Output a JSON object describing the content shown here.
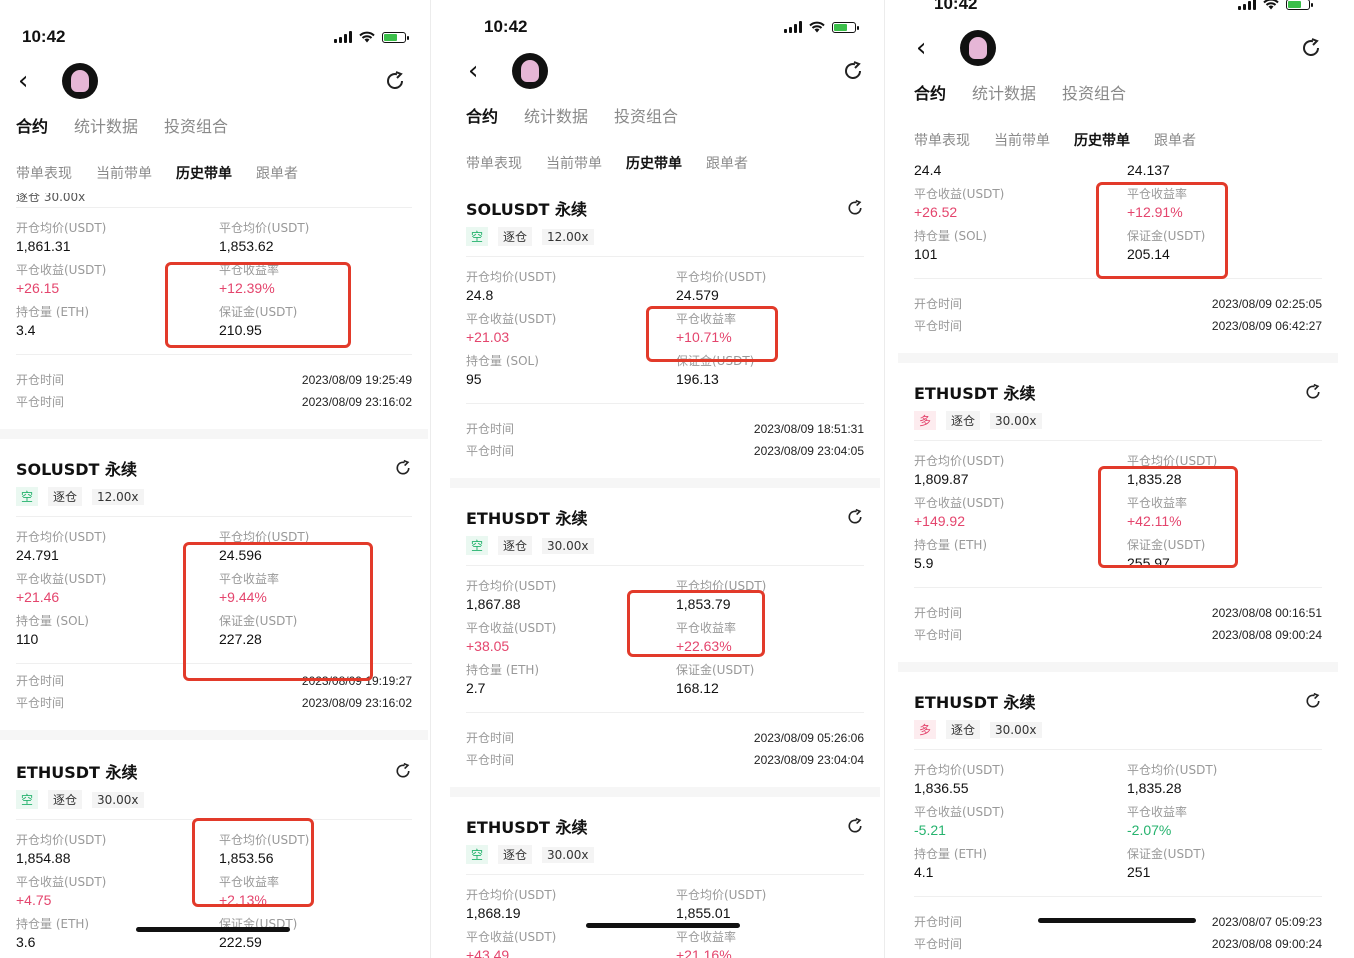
{
  "status": {
    "time": "10:42"
  },
  "tabs_main": [
    "合约",
    "统计数据",
    "投资组合"
  ],
  "tabs_sub": [
    "带单表现",
    "当前带单",
    "历史带单",
    "跟单者"
  ],
  "labels": {
    "open_avg": "开仓均价(USDT)",
    "close_avg": "平仓均价(USDT)",
    "close_pnl": "平仓收益(USDT)",
    "close_rate": "平仓收益率",
    "qty_eth": "持仓量 (ETH)",
    "qty_sol": "持仓量 (SOL)",
    "margin": "保证金(USDT)",
    "open_time": "开仓时间",
    "close_time": "平仓时间"
  },
  "tag_mode": "逐仓",
  "screen1": {
    "partial_top": "逐仓 30.00x",
    "card1": {
      "open_avg": "1,861.31",
      "close_avg": "1,853.62",
      "pnl": "+26.15",
      "rate": "+12.39%",
      "qty": "3.4",
      "margin": "210.95",
      "open_time": "2023/08/09 19:25:49",
      "close_time": "2023/08/09 23:16:02"
    },
    "card2": {
      "title": "SOLUSDT 永续",
      "side": "空",
      "lev": "12.00x",
      "open_avg": "24.791",
      "close_avg": "24.596",
      "pnl": "+21.46",
      "rate": "+9.44%",
      "qty": "110",
      "margin": "227.28",
      "open_time": "2023/08/09 19:19:27",
      "close_time": "2023/08/09 23:16:02"
    },
    "card3": {
      "title": "ETHUSDT 永续",
      "side": "空",
      "lev": "30.00x",
      "open_avg": "1,854.88",
      "close_avg": "1,853.56",
      "pnl": "+4.75",
      "rate": "+2.13%",
      "qty": "3.6",
      "margin": "222.59"
    }
  },
  "screen2": {
    "card1": {
      "title": "SOLUSDT 永续",
      "side": "空",
      "lev": "12.00x",
      "open_avg": "24.8",
      "close_avg": "24.579",
      "pnl": "+21.03",
      "rate": "+10.71%",
      "qty": "95",
      "margin": "196.13",
      "open_time": "2023/08/09 18:51:31",
      "close_time": "2023/08/09 23:04:05"
    },
    "card2": {
      "title": "ETHUSDT 永续",
      "side": "空",
      "lev": "30.00x",
      "open_avg": "1,867.88",
      "close_avg": "1,853.79",
      "pnl": "+38.05",
      "rate": "+22.63%",
      "qty": "2.7",
      "margin": "168.12",
      "open_time": "2023/08/09 05:26:06",
      "close_time": "2023/08/09 23:04:04"
    },
    "card3": {
      "title": "ETHUSDT 永续",
      "side": "空",
      "lev": "30.00x",
      "open_avg": "1,868.19",
      "close_avg": "1,855.01",
      "pnl": "+43.49",
      "rate": "+21.16%"
    }
  },
  "screen3": {
    "card1": {
      "open_avg": "24.4",
      "close_avg": "24.137",
      "pnl": "+26.52",
      "rate": "+12.91%",
      "qty": "101",
      "margin": "205.14",
      "open_time": "2023/08/09 02:25:05",
      "close_time": "2023/08/09 06:42:27"
    },
    "card2": {
      "title": "ETHUSDT 永续",
      "side": "多",
      "lev": "30.00x",
      "open_avg": "1,809.87",
      "close_avg": "1,835.28",
      "pnl": "+149.92",
      "rate": "+42.11%",
      "qty": "5.9",
      "margin": "255.97",
      "open_time": "2023/08/08 00:16:51",
      "close_time": "2023/08/08 09:00:24"
    },
    "card3": {
      "title": "ETHUSDT 永续",
      "side": "多",
      "lev": "30.00x",
      "open_avg": "1,836.55",
      "close_avg": "1,835.28",
      "pnl": "-5.21",
      "rate": "-2.07%",
      "qty": "4.1",
      "margin": "251",
      "open_time": "2023/08/07 05:09:23",
      "close_time": "2023/08/08 09:00:24"
    }
  }
}
